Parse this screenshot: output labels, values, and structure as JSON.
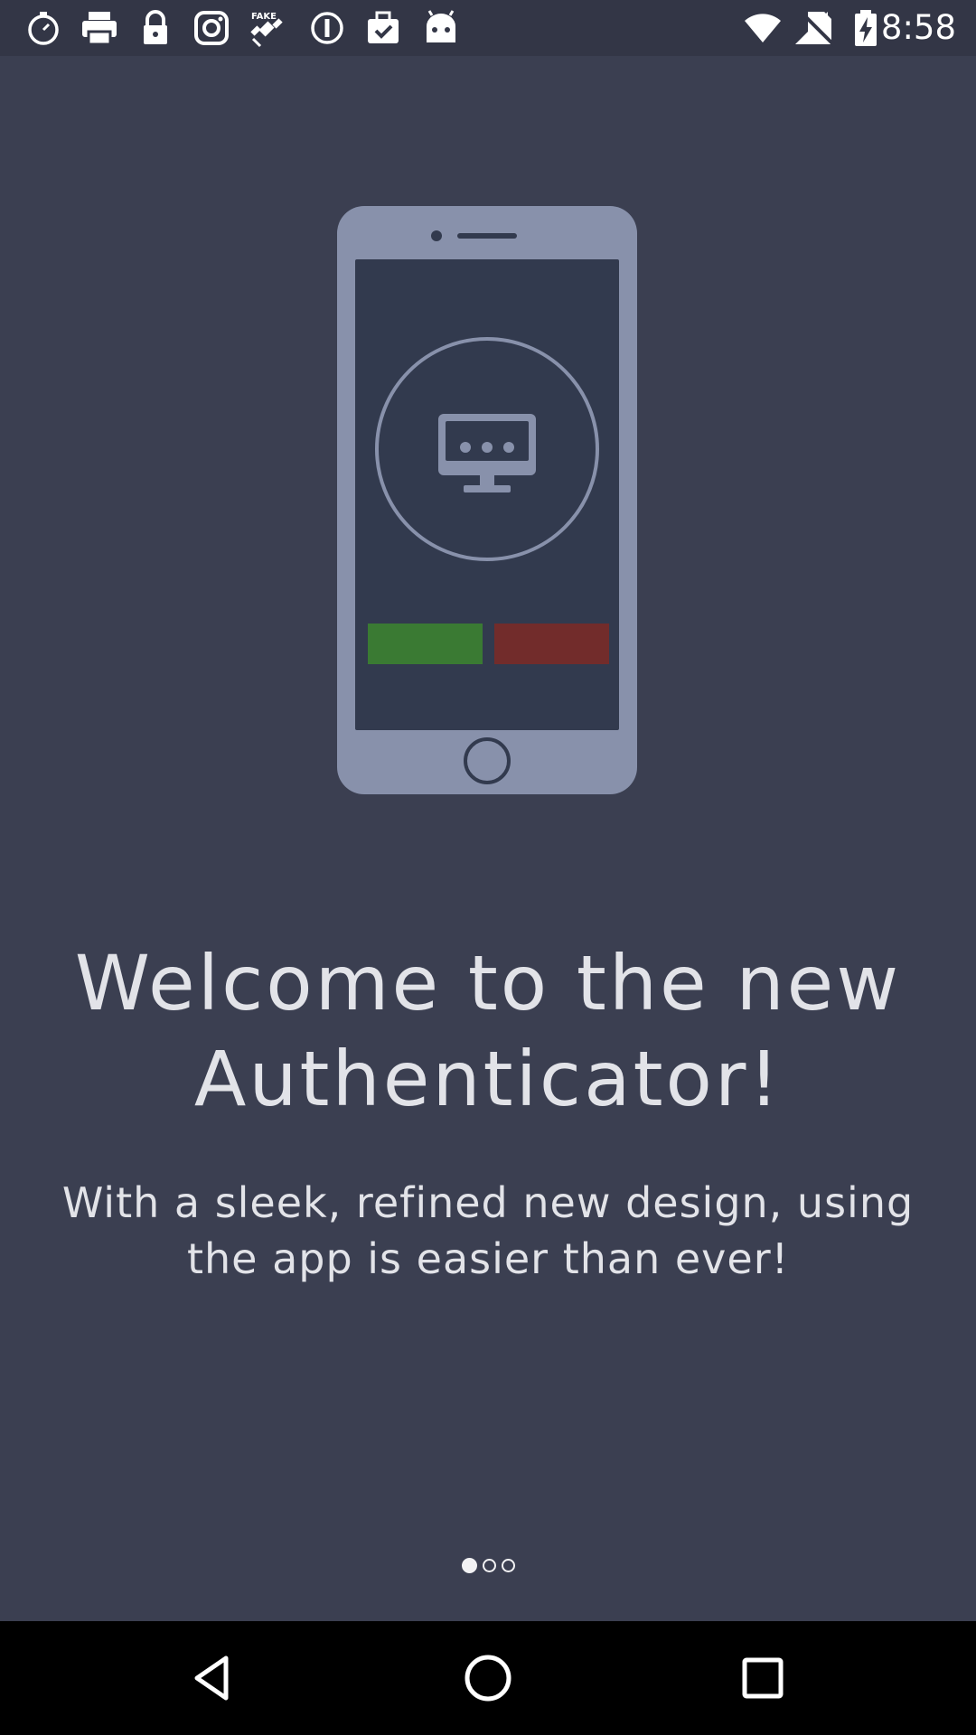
{
  "status_bar": {
    "time": "8:58",
    "left_icons": [
      "stopwatch-icon",
      "printer-icon",
      "lock-icon",
      "instagram-icon",
      "fake-gps-icon",
      "info-icon",
      "task-check-icon",
      "android-icon"
    ],
    "right_icons": [
      "wifi-icon",
      "signal-icon",
      "no-sim-icon",
      "battery-charging-icon"
    ]
  },
  "illustration": {
    "phone_color": "#8891ab",
    "screen_color": "#323a4e",
    "approve_color": "#3a7a33",
    "deny_color": "#722c2b",
    "center_icon": "monitor-dots-icon"
  },
  "onboarding": {
    "title": "Welcome to the new Authenticator!",
    "subtitle": "With a sleek, refined new design, using the app is easier than ever!"
  },
  "pager": {
    "page_count": 3,
    "current_page": 1
  },
  "nav_bar": {
    "back": "back-icon",
    "home": "home-icon",
    "recents": "recents-icon"
  },
  "colors": {
    "background": "#3b3f51",
    "status_bar": "#333646",
    "text": "#e2e3e8"
  }
}
